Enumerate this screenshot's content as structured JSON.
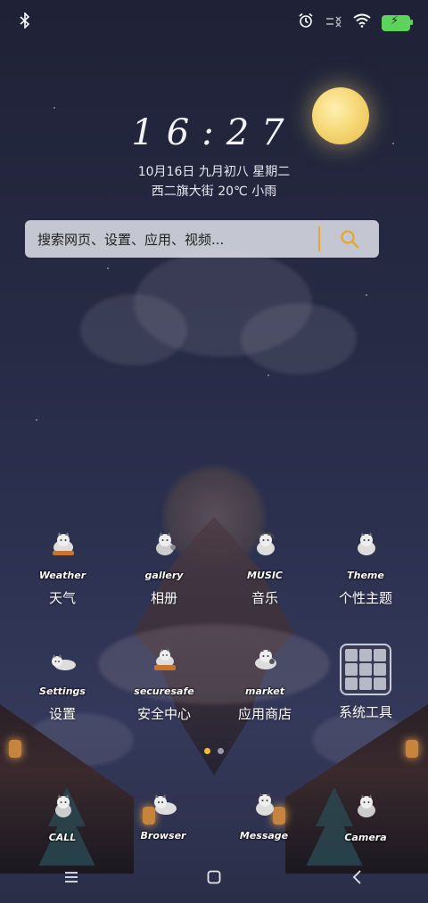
{
  "status_bar": {
    "bluetooth_icon": "bluetooth-icon",
    "alarm_icon": "alarm-icon",
    "signal_icon": "no-signal-icon",
    "wifi_icon": "wifi-icon",
    "battery_icon": "battery-charging-icon"
  },
  "clock": {
    "time": "16:27",
    "date": "10月16日 九月初八 星期二",
    "weather": "西二旗大街 20℃ 小雨"
  },
  "search": {
    "placeholder": "搜索网页、设置、应用、视频...",
    "icon": "search-icon"
  },
  "apps": [
    {
      "label": "天气",
      "caption": "Weather"
    },
    {
      "label": "相册",
      "caption": "gallery"
    },
    {
      "label": "音乐",
      "caption": "MUSIC"
    },
    {
      "label": "个性主题",
      "caption": "Theme"
    },
    {
      "label": "设置",
      "caption": "Settings"
    },
    {
      "label": "安全中心",
      "caption": "securesafe"
    },
    {
      "label": "应用商店",
      "caption": "market"
    },
    {
      "label": "系统工具",
      "caption": ""
    }
  ],
  "pages": {
    "count": 2,
    "active": 1
  },
  "dock": [
    {
      "caption": "CALL"
    },
    {
      "caption": "Browser"
    },
    {
      "caption": "Message"
    },
    {
      "caption": "Camera"
    }
  ],
  "navbar": {
    "menu_icon": "menu-icon",
    "home_icon": "home-icon",
    "back_icon": "back-icon"
  },
  "colors": {
    "accent": "#f0bd3a",
    "battery": "#5fd25d",
    "moon": "#f6d978"
  }
}
